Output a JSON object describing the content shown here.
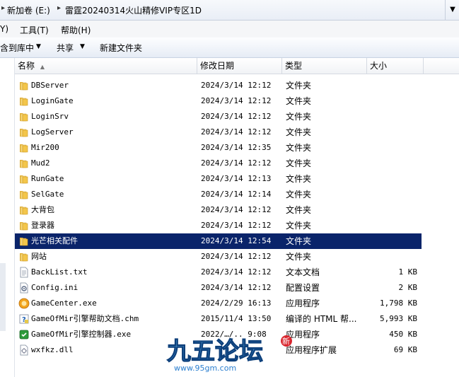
{
  "address": {
    "computer_prefix": "新加卷 (E:)",
    "folder": "雷霆20240314火山精修VIP专区1D"
  },
  "menu": {
    "view": "Y)",
    "tools": "工具(T)",
    "help": "帮助(H)"
  },
  "toolbar": {
    "include_library": "含到库中",
    "share": "共享",
    "new_folder": "新建文件夹"
  },
  "columns": {
    "name": "名称",
    "date": "修改日期",
    "type": "类型",
    "size": "大小"
  },
  "files": [
    {
      "name": "DBServer",
      "date": "2024/3/14 12:12",
      "type": "文件夹",
      "size": "",
      "icon": "folder-icon"
    },
    {
      "name": "LoginGate",
      "date": "2024/3/14 12:12",
      "type": "文件夹",
      "size": "",
      "icon": "folder-icon"
    },
    {
      "name": "LoginSrv",
      "date": "2024/3/14 12:12",
      "type": "文件夹",
      "size": "",
      "icon": "folder-icon"
    },
    {
      "name": "LogServer",
      "date": "2024/3/14 12:12",
      "type": "文件夹",
      "size": "",
      "icon": "folder-icon"
    },
    {
      "name": "Mir200",
      "date": "2024/3/14 12:35",
      "type": "文件夹",
      "size": "",
      "icon": "folder-icon"
    },
    {
      "name": "Mud2",
      "date": "2024/3/14 12:12",
      "type": "文件夹",
      "size": "",
      "icon": "folder-icon"
    },
    {
      "name": "RunGate",
      "date": "2024/3/14 12:13",
      "type": "文件夹",
      "size": "",
      "icon": "folder-icon"
    },
    {
      "name": "SelGate",
      "date": "2024/3/14 12:14",
      "type": "文件夹",
      "size": "",
      "icon": "folder-icon"
    },
    {
      "name": "大背包",
      "date": "2024/3/14 12:12",
      "type": "文件夹",
      "size": "",
      "icon": "folder-icon"
    },
    {
      "name": "登录器",
      "date": "2024/3/14 12:12",
      "type": "文件夹",
      "size": "",
      "icon": "folder-icon"
    },
    {
      "name": "光芒相关配件",
      "date": "2024/3/14 12:54",
      "type": "文件夹",
      "size": "",
      "icon": "folder-icon",
      "selected": true
    },
    {
      "name": "网站",
      "date": "2024/3/14 12:12",
      "type": "文件夹",
      "size": "",
      "icon": "folder-icon"
    },
    {
      "name": "BackList.txt",
      "date": "2024/3/14 12:12",
      "type": "文本文档",
      "size": "1 KB",
      "icon": "text-file-icon"
    },
    {
      "name": "Config.ini",
      "date": "2024/3/14 12:12",
      "type": "配置设置",
      "size": "2 KB",
      "icon": "settings-file-icon"
    },
    {
      "name": "GameCenter.exe",
      "date": "2024/2/29 16:13",
      "type": "应用程序",
      "size": "1,798 KB",
      "icon": "app-orange-icon"
    },
    {
      "name": "GameOfMir引擎帮助文档.chm",
      "date": "2015/11/4 13:50",
      "type": "编译的 HTML 帮...",
      "size": "5,993 KB",
      "icon": "help-file-icon"
    },
    {
      "name": "GameOfMir引擎控制器.exe",
      "date": "2022/…/.. 9:08",
      "type": "应用程序",
      "size": "450 KB",
      "icon": "app-green-icon"
    },
    {
      "name": "wxfkz.dll",
      "date": "",
      "type": "应用程序扩展",
      "size": "69 KB",
      "icon": "dll-file-icon"
    }
  ],
  "watermark": {
    "brand": "九五论坛",
    "url": "www.95gm.com",
    "badge": "新"
  },
  "colors": {
    "selection": "#0a246a",
    "folder": "#f3c64b"
  }
}
